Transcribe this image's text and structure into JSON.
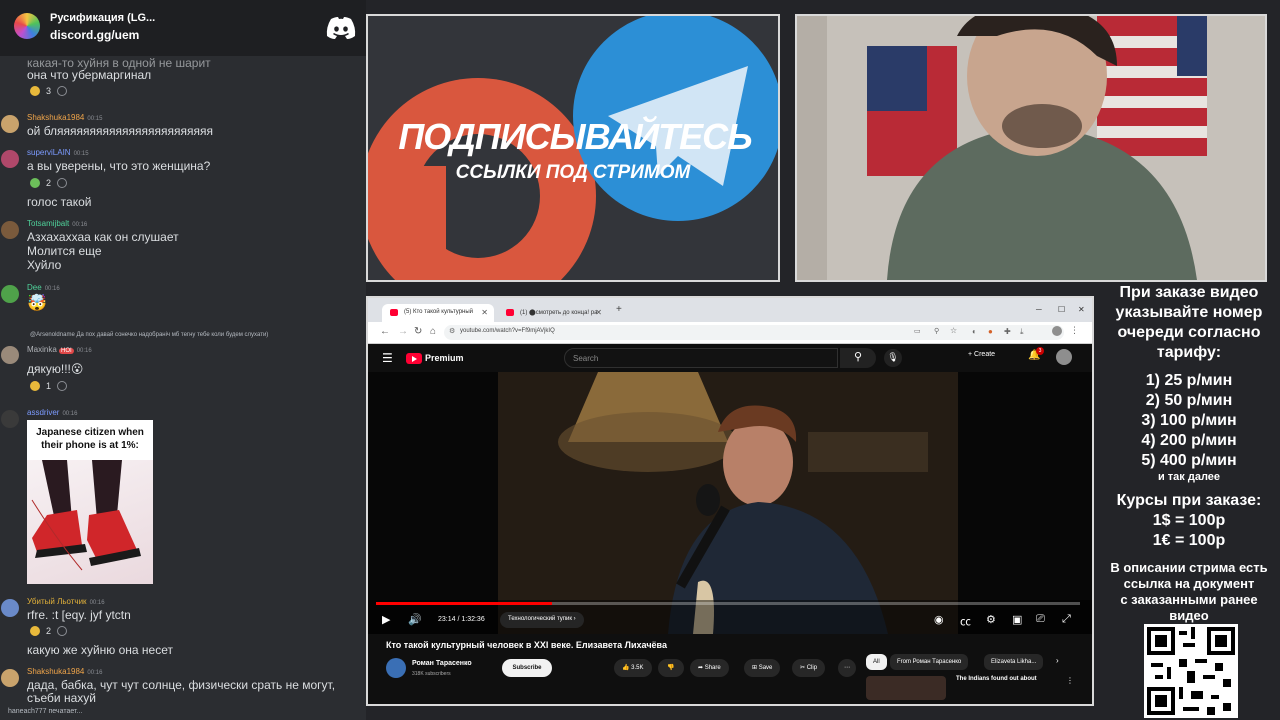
{
  "discord": {
    "server_name": "Русификация (LG...",
    "invite": "discord.gg/uem"
  },
  "chat": {
    "messages": [
      {
        "text_lines": [
          "какая-то хуйня в одной не шарит",
          "она что убермаргинал"
        ],
        "reactions": [
          {
            "emoji": "laugh",
            "count": "3"
          }
        ]
      },
      {
        "user": "Shakshuka1984",
        "user_color": "#f0a54a",
        "time": "00:15",
        "text_lines": [
          "ой бляяяяяяяяяяяяяяяяяяяяяяяя"
        ]
      },
      {
        "user": "superviLAIN",
        "user_color": "#7c9bff",
        "time": "00:15",
        "text_lines": [
          "а вы уверены, что это женщина?"
        ],
        "reactions": [
          {
            "emoji": "cool",
            "count": "2"
          }
        ]
      },
      {
        "text_lines": [
          "голос такой"
        ]
      },
      {
        "user": "Totsamijbalt",
        "user_color": "#4fd19a",
        "time": "00:16",
        "text_lines": [
          "Азхахаххаа как он слушает",
          "Молится еще",
          "Хуйло"
        ]
      },
      {
        "user": "Dee",
        "user_color": "#4fd19a",
        "time": "00:16",
        "text_lines": [
          "🤯"
        ]
      },
      {
        "reply_text": "@Arsenoldname Да пох давай сонечко надобранiч мб тегну тебе коли будем слухати)",
        "user": "Maxinka",
        "user_color": "#b0b3b8",
        "time": "00:16",
        "badge": "HOI",
        "text_lines": [
          "дякую!!!😮"
        ],
        "reactions": [
          {
            "emoji": "hug",
            "count": "1"
          }
        ]
      },
      {
        "user": "assdriver",
        "user_color": "#7c9bff",
        "time": "00:16",
        "image_caption": "Japanese citizen when their phone is at 1%:"
      },
      {
        "user": "Убитый Льотчик",
        "user_color": "#e0b03a",
        "time": "00:16",
        "text_lines": [
          "rfre. :t [eqy. jyf ytctn",
          "какую же хуйню она несет"
        ],
        "reactions": [
          {
            "emoji": "laugh",
            "count": "2"
          }
        ]
      },
      {
        "user": "Shakshuka1984",
        "user_color": "#f0a54a",
        "time": "00:16",
        "text_lines": [
          "дада, бабка, чут чут солнце, физически срать не могут,",
          "съеби нахуй"
        ]
      }
    ],
    "typing": "haneach777 печатает..."
  },
  "promo": {
    "title": "ПОДПИСЫВАЙТЕСЬ",
    "subtitle": "ССЫЛКИ ПОД СТРИМОМ"
  },
  "browser": {
    "tabs": [
      {
        "title": "(5) Кто такой культурный"
      },
      {
        "title": "(1) ⬤смотреть до конца! ра"
      }
    ],
    "url": "youtube.com/watch?v=Ff9mjAVjkIQ",
    "youtube": {
      "brand": "Premium",
      "search_placeholder": "Search",
      "create_label": "Create",
      "notifications": "3",
      "player": {
        "time": "23:14 / 1:32:36",
        "chapter": "Технологический тупик",
        "progress": 0.25
      },
      "video_title": "Кто такой культурный человек в XXI веке. Елизавета Лихачёва",
      "channel": "Роман Тарасенко",
      "subscribers": "318K subscribers",
      "subscribe_label": "Subscribe",
      "likes": "3.5K",
      "share_label": "Share",
      "save_label": "Save",
      "clip_label": "Clip",
      "chips": [
        "All",
        "From Роман Тарасенко",
        "Elizaveta Likha..."
      ],
      "rec_title": "The Indians found out about"
    }
  },
  "pricing": {
    "intro_lines": [
      "При заказе видео",
      "указывайте номер",
      "очереди согласно",
      "тарифу:"
    ],
    "tiers": [
      "1) 25 р/мин",
      "2) 50 р/мин",
      "3) 100 р/мин",
      "4) 200 р/мин",
      "5) 400 р/мин"
    ],
    "etc": "и так далее",
    "rates_title": "Курсы при заказе:",
    "rates": [
      "1$ = 100р",
      "1€ = 100р"
    ],
    "doc_lines": [
      "В описании стрима есть",
      "ссылка на документ",
      "с заказанными ранее",
      "видео"
    ]
  }
}
